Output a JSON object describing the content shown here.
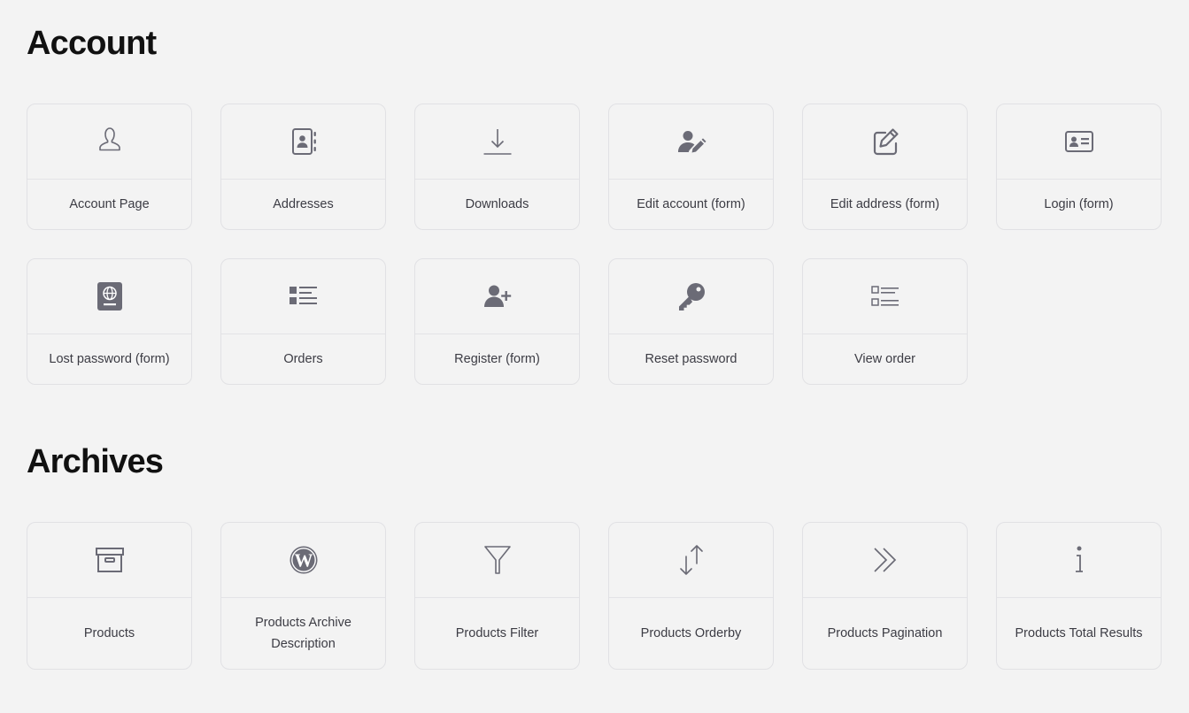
{
  "sections": [
    {
      "title": "Account",
      "cards": [
        {
          "label": "Account Page",
          "icon": "user-icon"
        },
        {
          "label": "Addresses",
          "icon": "address-book-icon"
        },
        {
          "label": "Downloads",
          "icon": "download-icon"
        },
        {
          "label": "Edit account (form)",
          "icon": "user-edit-icon"
        },
        {
          "label": "Edit address (form)",
          "icon": "edit-icon"
        },
        {
          "label": "Login (form)",
          "icon": "id-card-icon"
        },
        {
          "label": "Lost password (form)",
          "icon": "passport-icon"
        },
        {
          "label": "Orders",
          "icon": "list-icon"
        },
        {
          "label": "Register (form)",
          "icon": "user-plus-icon"
        },
        {
          "label": "Reset password",
          "icon": "key-icon"
        },
        {
          "label": "View order",
          "icon": "checklist-icon"
        }
      ]
    },
    {
      "title": "Archives",
      "cards": [
        {
          "label": "Products",
          "icon": "archive-box-icon"
        },
        {
          "label": "Products Archive Description",
          "icon": "wordpress-icon"
        },
        {
          "label": "Products Filter",
          "icon": "filter-icon"
        },
        {
          "label": "Products Orderby",
          "icon": "sort-arrows-icon"
        },
        {
          "label": "Products Pagination",
          "icon": "double-chevron-right-icon"
        },
        {
          "label": "Products Total Results",
          "icon": "info-icon"
        }
      ]
    }
  ],
  "colors": {
    "background": "#f3f3f3",
    "card_border": "#e1e1e4",
    "icon": "#6b6b76",
    "heading": "#111111",
    "label": "#3c3c44"
  }
}
